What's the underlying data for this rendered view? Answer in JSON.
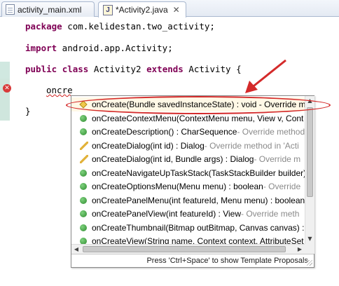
{
  "tabs": [
    {
      "label": "activity_main.xml",
      "icon": "xml-file-icon"
    },
    {
      "label": "*Activity2.java",
      "icon": "java-file-icon",
      "active": true
    }
  ],
  "editor": {
    "package_kw": "package",
    "package_rest": " com.kelidestan.two_activity;",
    "import_kw": "import",
    "import_rest": " android.app.Activity;",
    "class_kw1": "public",
    "class_kw2": "class",
    "class_name": " Activity2 ",
    "class_kw3": "extends",
    "class_rest": " Activity {",
    "typed_text": "oncre",
    "closing_brace": "}"
  },
  "completion": {
    "items": [
      {
        "icon": "override-diamond",
        "signature": "onCreate(Bundle savedInstanceState) : void - Override me",
        "detail": ""
      },
      {
        "icon": "public-method",
        "signature": "onCreateContextMenu(ContextMenu menu, View v, Cont",
        "detail": ""
      },
      {
        "icon": "public-method",
        "signature": "onCreateDescription() : CharSequence",
        "detail": " - Override method"
      },
      {
        "icon": "deprecated-method",
        "signature": "onCreateDialog(int id) : Dialog",
        "detail": " - Override method in 'Acti"
      },
      {
        "icon": "deprecated-method",
        "signature": "onCreateDialog(int id, Bundle args) : Dialog",
        "detail": " - Override m"
      },
      {
        "icon": "public-method",
        "signature": "onCreateNavigateUpTaskStack(TaskStackBuilder builder)",
        "detail": ""
      },
      {
        "icon": "public-method",
        "signature": "onCreateOptionsMenu(Menu menu) : boolean",
        "detail": " - Override"
      },
      {
        "icon": "public-method",
        "signature": "onCreatePanelMenu(int featureId, Menu menu) : boolean",
        "detail": ""
      },
      {
        "icon": "public-method",
        "signature": "onCreatePanelView(int featureId) : View",
        "detail": " - Override meth"
      },
      {
        "icon": "public-method",
        "signature": "onCreateThumbnail(Bitmap outBitmap, Canvas canvas) :",
        "detail": ""
      },
      {
        "icon": "public-method",
        "signature": "onCreateView(String name, Context context, AttributeSet",
        "detail": ""
      }
    ],
    "status_text": "Press 'Ctrl+Space' to show Template Proposals"
  },
  "colors": {
    "keyword": "#7f0055",
    "annotation": "#d42a2a",
    "error": "#d83a3a"
  }
}
